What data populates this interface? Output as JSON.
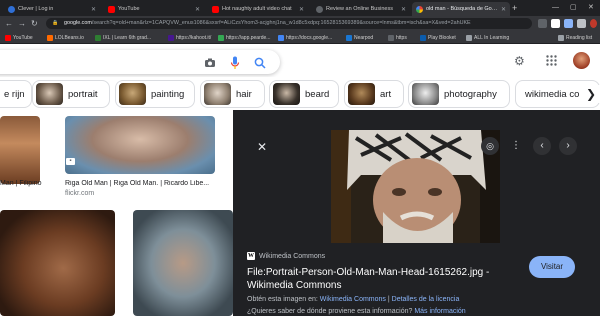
{
  "tabs": [
    {
      "title": "Clever | Log in",
      "color": "#2f6fd6"
    },
    {
      "title": "YouTube",
      "color": "#ff0000"
    },
    {
      "title": "Hot naughty adult video chat",
      "color": "#ff0000"
    },
    {
      "title": "Review an Online Business",
      "color": "#5f6368"
    },
    {
      "title": "old man - Búsqueda de Google",
      "color": "#4285f4"
    }
  ],
  "address": {
    "host": "google.com",
    "path": "/search?q=old+man&rlz=1CAPQVW_enus1086&sxsrf=ALiCzsYhom3-acjghnj1na_w1d8c5xdpq:1652815369389&source=lnms&tbm=isch&sa=X&ved=2ahUKE"
  },
  "bookmarks": [
    {
      "label": "YouTube",
      "color": "#ff0000"
    },
    {
      "label": "LOLBeans.io",
      "color": "#ff6a00"
    },
    {
      "label": "IXL | Learn 6th grad...",
      "color": "#2e7d32"
    },
    {
      "label": "https://kahoot.it/",
      "color": "#46178f"
    },
    {
      "label": "https://app.pearde...",
      "color": "#34a853"
    },
    {
      "label": "https://docs.google...",
      "color": "#4285f4"
    },
    {
      "label": "Nearpod",
      "color": "#1976d2"
    },
    {
      "label": "https",
      "color": "#5f6368"
    },
    {
      "label": "Play Blooket",
      "color": "#0b5cad"
    },
    {
      "label": "ALL In Learning",
      "color": "#9aa0a6"
    },
    {
      "label": "Reading list",
      "color": "#9aa0a6"
    }
  ],
  "chips": [
    {
      "label": "e rijn"
    },
    {
      "label": "portrait"
    },
    {
      "label": "painting"
    },
    {
      "label": "hair"
    },
    {
      "label": "beard"
    },
    {
      "label": "art"
    },
    {
      "label": "photography"
    },
    {
      "label": "wikimedia co"
    }
  ],
  "results": [
    {
      "caption": "Man | Filipino ...",
      "source": ""
    },
    {
      "caption": "Riga Old Man | Riga Old Man. | Ricardo Libe...",
      "source": "flickr.com"
    }
  ],
  "preview": {
    "source": "Wikimedia Commons",
    "title": "File:Portrait-Person-Old-Man-Man-Head-1615262.jpg - Wikimedia Commons",
    "desc_prefix": "Obtén esta imagen en:",
    "desc_link1": "Wikimedia Commons",
    "desc_sep": "|",
    "desc_link2": "Detalles de la licencia",
    "desc2_prefix": "¿Quieres saber de dónde proviene esta información?",
    "desc2_link": "Más información",
    "visit_label": "Visitar"
  }
}
